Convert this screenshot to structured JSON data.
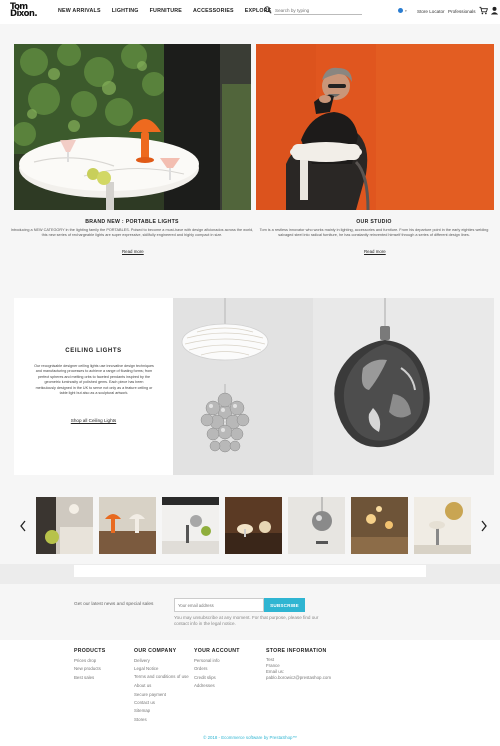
{
  "header": {
    "logo_line1": "Tom",
    "logo_line2": "Dixon.",
    "nav": [
      "NEW ARRIVALS",
      "LIGHTING",
      "FURNITURE",
      "ACCESSORIES",
      "EXPLORE"
    ],
    "search_placeholder": "Search by typing",
    "store_locator": "Store Locator",
    "professionals": "Professionals",
    "icons": [
      "search-icon",
      "flag-icon",
      "cart-icon",
      "user-icon"
    ]
  },
  "features": [
    {
      "title": "BRAND NEW : PORTABLE LIGHTS",
      "desc": "Introducing a NEW CATEGORY in the lighting family the PORTABLES. Poised to become a must-have with design aficionados across the world, this new series of rechargeable lights are super expressive, skillfully engineered and highly compact in size.",
      "link": "Read more"
    },
    {
      "title": "OUR STUDIO",
      "desc": "Tom is a restless innovator who works mainly in lighting, accessories and furniture. From his departure point in the early eighties welding salvaged steel into radical furniture, he has constantly reinvented himself through a series of different design lines.",
      "link": "Read more"
    }
  ],
  "ceiling": {
    "title": "CEILING LIGHTS",
    "body": "Our recognisable designer ceiling lights use innovative design techniques and manufacturing processes to achieve a range of floating forms; from perfect spheres and melting orbs to faceted pendants inspired by the geometric luminosity of polished gems. Each piece has been meticulously designed in the UK to serve not only as a feature ceiling or table light but also as a sculptural artwork.",
    "link": "Shop all Ceiling Lights"
  },
  "newsletter": {
    "label": "Get our latest news and special sales",
    "placeholder": "Your email address",
    "button": "SUBSCRIBE",
    "note": "You may unsubscribe at any moment. For that purpose, please find our contact info in the legal notice."
  },
  "footer": {
    "products": {
      "title": "PRODUCTS",
      "items": [
        "Prices drop",
        "New products",
        "Best sales"
      ]
    },
    "company": {
      "title": "OUR COMPANY",
      "items": [
        "Delivery",
        "Legal Notice",
        "Terms and conditions of use",
        "About us",
        "Secure payment",
        "Contact us",
        "Sitemap",
        "Stores"
      ]
    },
    "account": {
      "title": "YOUR ACCOUNT",
      "items": [
        "Personal info",
        "Orders",
        "Credit slips",
        "Addresses"
      ]
    },
    "store": {
      "title": "STORE INFORMATION",
      "items": [
        "Test",
        "France",
        "Email us:",
        "pablo.borowicz@prestashop.com"
      ]
    },
    "copyright": "© 2018 - Ecommerce software by PrestaShop™"
  },
  "colors": {
    "accent": "#2fb5d2",
    "orange": "#e8641f"
  }
}
